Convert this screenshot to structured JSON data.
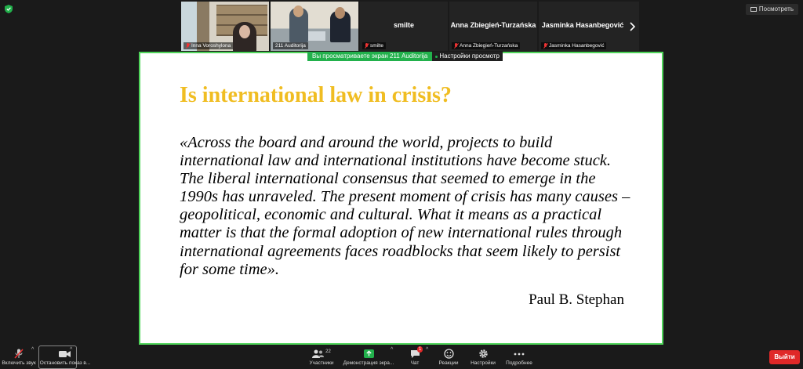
{
  "top": {
    "view_label": "Посмотреть"
  },
  "participants": [
    {
      "name": "Inna Voroshylona",
      "type": "video"
    },
    {
      "name": "211 Auditorija",
      "type": "video"
    },
    {
      "name": "smilte",
      "type": "name"
    },
    {
      "name": "Anna Zbiegień-Turzańska",
      "type": "name"
    },
    {
      "name": "Jasminka Hasanbegović",
      "type": "name"
    }
  ],
  "share_banner": {
    "viewing_text": "Вы просматриваете экран 211 Auditorija",
    "settings_text": "Настройки просмотр"
  },
  "slide": {
    "title": "Is international law in crisis?",
    "quote": "«Across the board and around the world, projects to build international law and international institutions have become stuck. The liberal international consensus that seemed to emerge in the 1990s has unraveled. The present moment of crisis has many causes – geopolitical, economic and cultural. What it means as a practical matter is that the formal adoption of new international rules through international agreements faces roadblocks that seem likely to persist for some time».",
    "author": "Paul B. Stephan",
    "title_color": "#f0bd22"
  },
  "toolbar": {
    "mic_label": "Включить звук",
    "video_label": "Остановить показ в...",
    "participants_label": "Участники",
    "participants_count": "22",
    "share_label": "Демонстрация экра...",
    "chat_label": "Чат",
    "chat_badge": "1",
    "reactions_label": "Реакции",
    "settings_label": "Настройки",
    "more_label": "Подробнее",
    "exit_label": "Выйти"
  }
}
